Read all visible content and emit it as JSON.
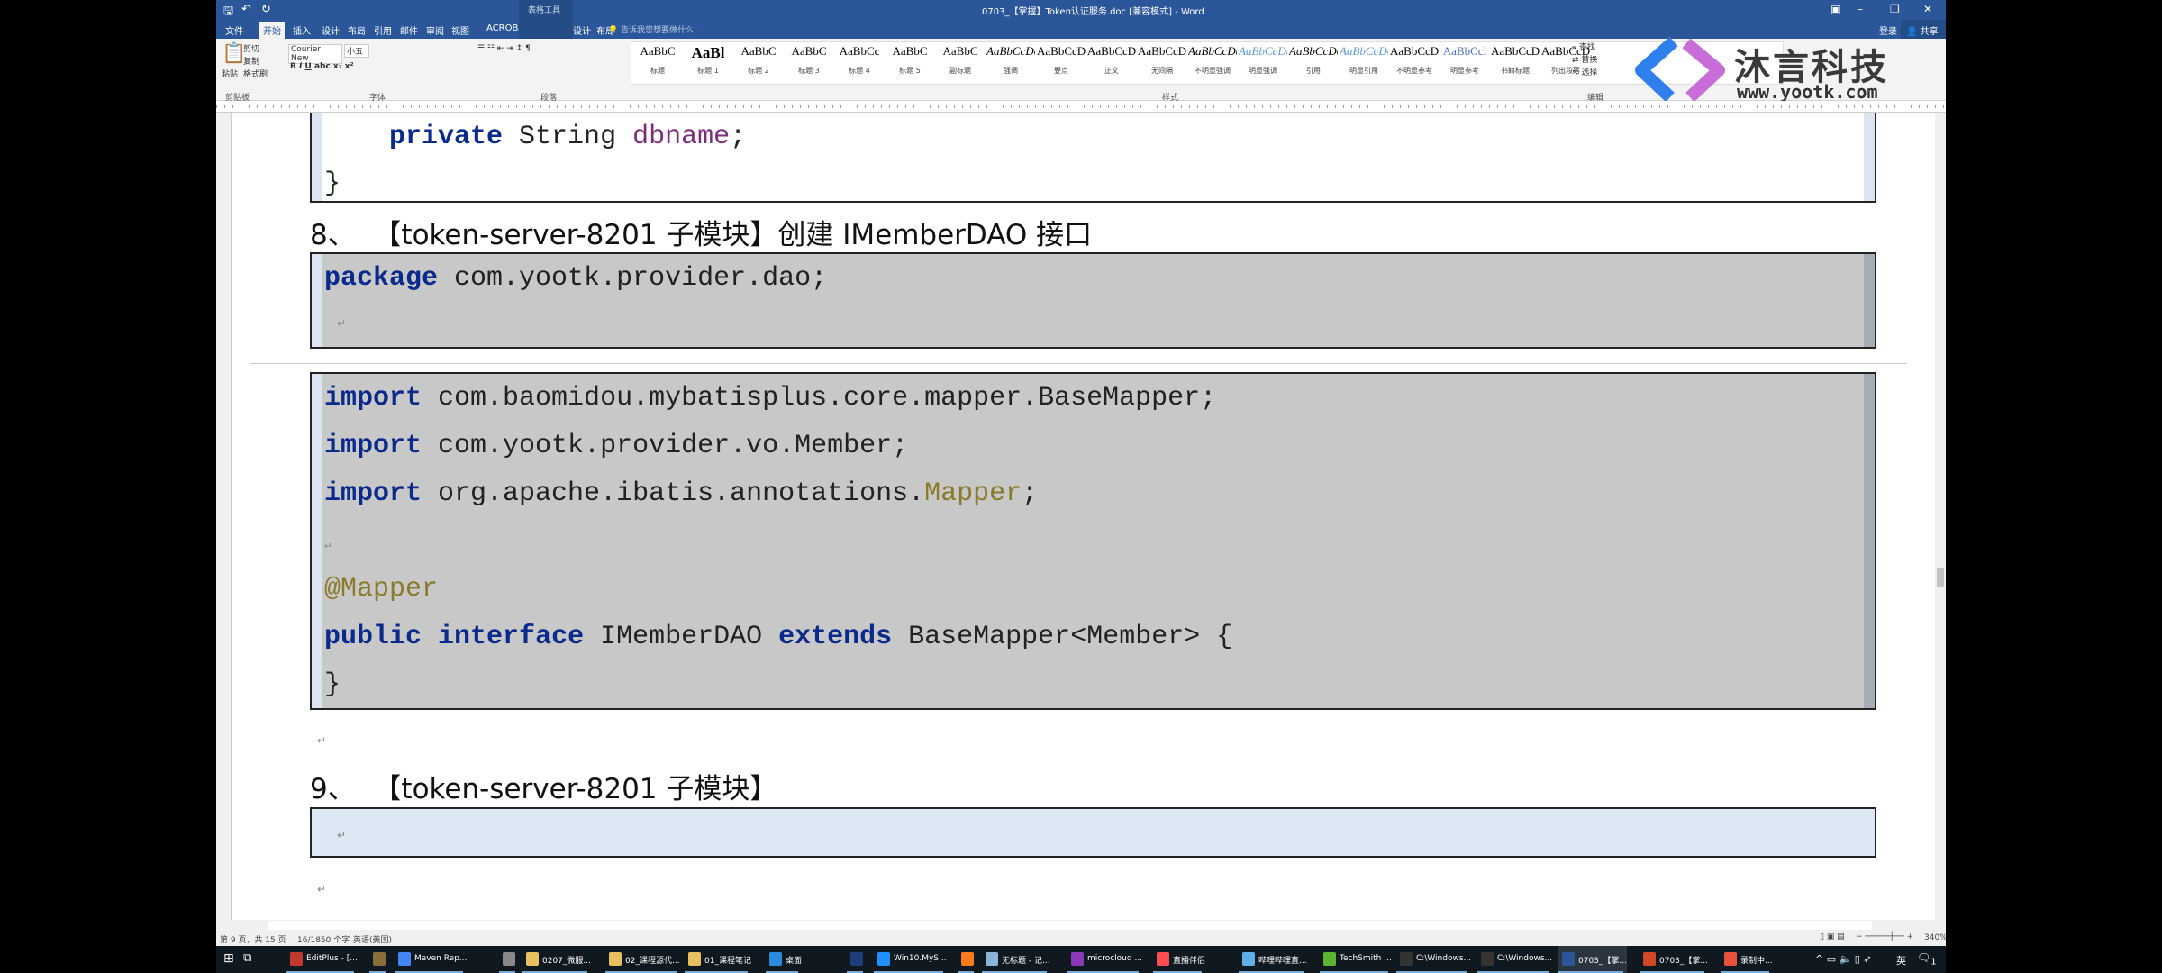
{
  "window": {
    "title": "0703_【掌握】Token认证服务.doc [兼容模式] - Word",
    "context_tab_group": "表格工具",
    "login": "登录",
    "share": "共享"
  },
  "tabs": [
    "文件",
    "开始",
    "插入",
    "设计",
    "布局",
    "引用",
    "邮件",
    "审阅",
    "视图",
    "ACROBAT",
    "设计",
    "布局"
  ],
  "active_tab": "开始",
  "tell_me": "告诉我您想要做什么...",
  "ribbon": {
    "clipboard": {
      "paste": "粘贴",
      "cut": "剪切",
      "copy": "复制",
      "format_painter": "格式刷",
      "group": "剪贴板"
    },
    "font": {
      "name": "Courier New",
      "size": "小五",
      "group": "字体"
    },
    "paragraph": {
      "group": "段落"
    },
    "styles_group": "样式",
    "styles": [
      {
        "sample": "AaBbC",
        "label": "标题"
      },
      {
        "sample": "AaBl",
        "label": "标题 1"
      },
      {
        "sample": "AaBbC",
        "label": "标题 2"
      },
      {
        "sample": "AaBbC",
        "label": "标题 3"
      },
      {
        "sample": "AaBbCc",
        "label": "标题 4"
      },
      {
        "sample": "AaBbC",
        "label": "标题 5"
      },
      {
        "sample": "AaBbC",
        "label": "副标题"
      },
      {
        "sample": "AaBbCcDc",
        "label": "强调"
      },
      {
        "sample": "AaBbCcD",
        "label": "要点"
      },
      {
        "sample": "AaBbCcDc",
        "label": "正文"
      },
      {
        "sample": "AaBbCcDc",
        "label": "无间隔"
      },
      {
        "sample": "AaBbCcDc",
        "label": "不明显强调"
      },
      {
        "sample": "AaBbCcDc",
        "label": "明显强调"
      },
      {
        "sample": "AaBbCcDc",
        "label": "引用"
      },
      {
        "sample": "AaBbCcDc",
        "label": "明显引用"
      },
      {
        "sample": "AaBbCcD",
        "label": "不明显参考"
      },
      {
        "sample": "AaBbCcl",
        "label": "明显参考"
      },
      {
        "sample": "AaBbCcD",
        "label": "书籍标题"
      },
      {
        "sample": "AaBbCcDc",
        "label": "列出段落"
      }
    ],
    "editing": {
      "find": "查找",
      "replace": "替换",
      "select": "选择",
      "group": "编辑"
    }
  },
  "watermark": {
    "brand": "沐言科技",
    "url": "www.yootk.com",
    "colors": [
      "#2f80ed",
      "#c86dd7"
    ]
  },
  "document": {
    "block_prev": [
      [
        [
          "    ",
          ""
        ],
        [
          "private",
          "kw"
        ],
        [
          " String ",
          ""
        ],
        [
          "dbname",
          "fd"
        ],
        [
          ";",
          ""
        ]
      ],
      [
        [
          "}",
          ""
        ]
      ]
    ],
    "heading8": "8、  【token-server-8201 子模块】创建 IMemberDAO 接口",
    "block_package": [
      [
        [
          "package",
          "kw"
        ],
        [
          " com.yootk.provider.dao;",
          ""
        ]
      ]
    ],
    "block_main": [
      [
        [
          "import",
          "kw"
        ],
        [
          " com.baomidou.mybatisplus.core.mapper.BaseMapper;",
          ""
        ]
      ],
      [
        [
          "import",
          "kw"
        ],
        [
          " com.yootk.provider.vo.Member;",
          ""
        ]
      ],
      [
        [
          "import",
          "kw"
        ],
        [
          " org.apache.ibatis.annotations.",
          ""
        ],
        [
          "Mapper",
          "an"
        ],
        [
          ";",
          ""
        ]
      ],
      [],
      [
        [
          "@Mapper",
          "an"
        ]
      ],
      [
        [
          "public",
          "kw"
        ],
        [
          " ",
          ""
        ],
        [
          "interface",
          "kw"
        ],
        [
          " IMemberDAO ",
          ""
        ],
        [
          "extends",
          "kw"
        ],
        [
          " BaseMapper<Member> {",
          ""
        ]
      ],
      [
        [
          "}",
          ""
        ]
      ]
    ],
    "heading9": "9、  【token-server-8201 子模块】",
    "colors": {
      "keyword": "#0b2b8c",
      "annotation": "#8a7a2a",
      "field": "#7b2d7b",
      "code_bg": "#c8c8c8",
      "empty_box_bg": "#dde8f5"
    }
  },
  "status": {
    "page": "第 9 页，共 15 页",
    "words": "16/1850 个字",
    "language": "英语(美国)",
    "zoom": "340%"
  },
  "taskbar": [
    {
      "label": "EditPlus - [...",
      "color": "#c0392b"
    },
    {
      "label": "",
      "color": "#8a6d3b"
    },
    {
      "label": "Maven Rep...",
      "color": "#4285f4"
    },
    {
      "label": "",
      "color": "#888"
    },
    {
      "label": "0207_微服...",
      "color": "#e8c060"
    },
    {
      "label": "02_课程源代...",
      "color": "#e8c060"
    },
    {
      "label": "01_课程笔记",
      "color": "#e8c060"
    },
    {
      "label": "桌面",
      "color": "#2a8ae0"
    },
    {
      "label": "",
      "color": "#1d3c7a"
    },
    {
      "label": "Win10.MyS...",
      "color": "#1e90ff"
    },
    {
      "label": "",
      "color": "#ff7a1a"
    },
    {
      "label": "无标题 - 记...",
      "color": "#8ab4d8"
    },
    {
      "label": "microcloud ...",
      "color": "#8a3ab9"
    },
    {
      "label": "直播伴侣",
      "color": "#ff4d4f"
    },
    {
      "label": "哔哩哔哩直...",
      "color": "#5fb0e8"
    },
    {
      "label": "TechSmith ...",
      "color": "#5cb531"
    },
    {
      "label": "C:\\Windows...",
      "color": "#333"
    },
    {
      "label": "C:\\Windows...",
      "color": "#333"
    },
    {
      "label": "0703_【掌...",
      "color": "#2b579a"
    },
    {
      "label": "0703_【掌...",
      "color": "#d24726"
    },
    {
      "label": "录制中...",
      "color": "#e8523a"
    }
  ],
  "tray": {
    "ime": "英",
    "notifications": "1"
  }
}
